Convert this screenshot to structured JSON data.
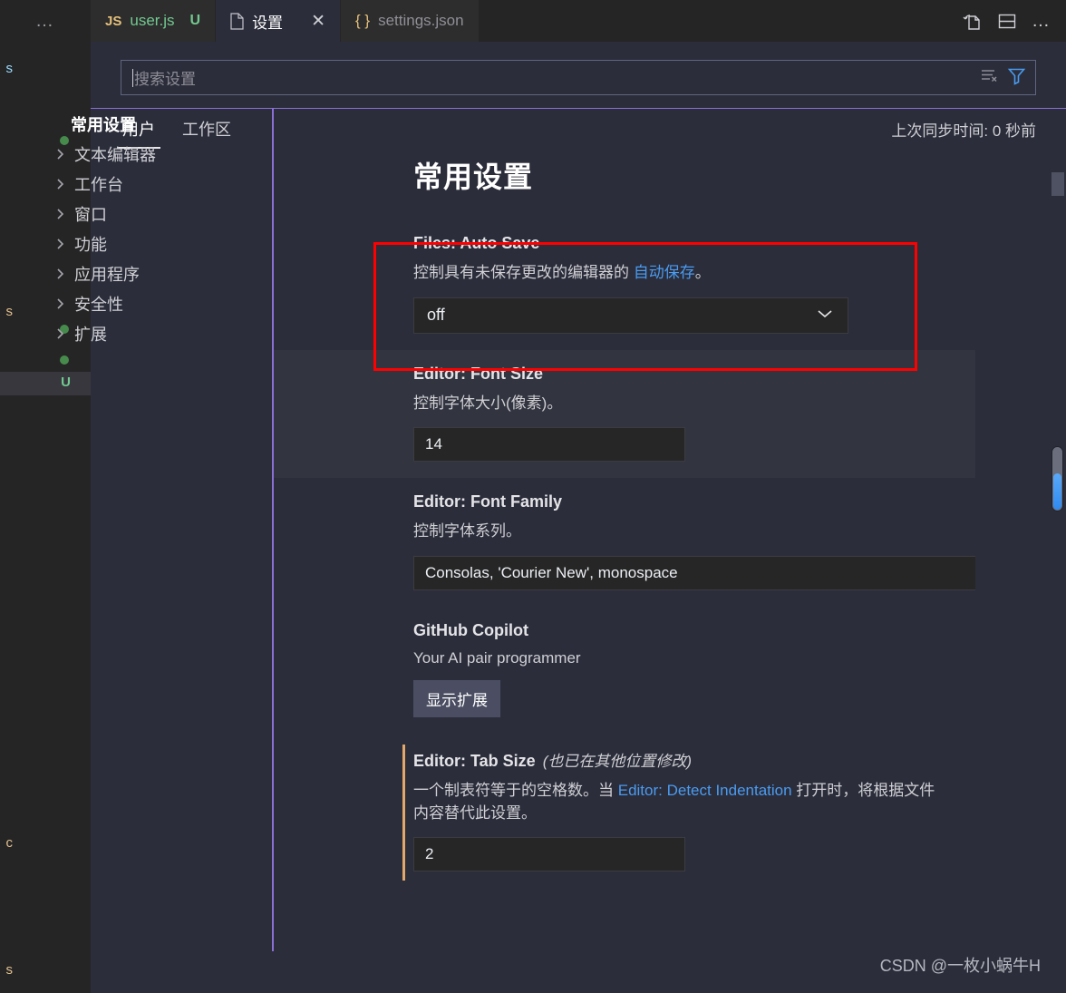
{
  "window": {
    "tabbar": {
      "overflow_label": "…",
      "tabs": [
        {
          "icon": "js-file-icon",
          "label": "user.js",
          "badge": "U",
          "active": false,
          "closable": false
        },
        {
          "icon": "settings-file-icon",
          "label": "设置",
          "badge": "",
          "active": true,
          "closable": true
        },
        {
          "icon": "json-file-icon",
          "label": "settings.json",
          "badge": "",
          "active": false,
          "closable": false
        }
      ],
      "close_label": "✕",
      "actions": [
        {
          "name": "open-changes-icon",
          "label": ""
        },
        {
          "name": "split-editor-icon",
          "label": ""
        },
        {
          "name": "more-actions-icon",
          "label": "…"
        }
      ]
    }
  },
  "explorer": {
    "fragments": [
      {
        "text": "s",
        "color": "blue"
      },
      {
        "text": "s",
        "color": "orange"
      },
      {
        "text": "c",
        "color": "orange"
      },
      {
        "text": "s",
        "color": "orange"
      }
    ],
    "badge": "U"
  },
  "search": {
    "placeholder": "搜索设置",
    "value": "",
    "clear_icon": "clear-settings-search-icon",
    "filter_icon": "filter-icon"
  },
  "scope": {
    "tabs": [
      {
        "label": "用户",
        "active": true
      },
      {
        "label": "工作区",
        "active": false
      }
    ],
    "sync_status": "上次同步时间: 0 秒前"
  },
  "toc": {
    "items": [
      {
        "label": "常用设置",
        "root": true,
        "selected": true
      },
      {
        "label": "文本编辑器",
        "root": false,
        "selected": false
      },
      {
        "label": "工作台",
        "root": false,
        "selected": false
      },
      {
        "label": "窗口",
        "root": false,
        "selected": false
      },
      {
        "label": "功能",
        "root": false,
        "selected": false
      },
      {
        "label": "应用程序",
        "root": false,
        "selected": false
      },
      {
        "label": "安全性",
        "root": false,
        "selected": false
      },
      {
        "label": "扩展",
        "root": false,
        "selected": false
      }
    ]
  },
  "main": {
    "page_title": "常用设置",
    "settings": [
      {
        "key": "files-auto-save",
        "title": "Files: Auto Save",
        "note": "",
        "desc_before": "控制具有未保存更改的编辑器的 ",
        "desc_link": "自动保存",
        "desc_after": "。",
        "control": "select",
        "value": "off",
        "modified": false,
        "hovered": false
      },
      {
        "key": "editor-font-size",
        "title": "Editor: Font Size",
        "note": "",
        "desc_before": "控制字体大小(像素)。",
        "desc_link": "",
        "desc_after": "",
        "control": "input-small",
        "value": "14",
        "modified": false,
        "hovered": true
      },
      {
        "key": "editor-font-family",
        "title": "Editor: Font Family",
        "note": "",
        "desc_before": "控制字体系列。",
        "desc_link": "",
        "desc_after": "",
        "control": "input-wide",
        "value": "Consolas, 'Courier New', monospace",
        "modified": false,
        "hovered": false
      },
      {
        "key": "github-copilot",
        "title": "GitHub Copilot",
        "note": "",
        "desc_before": "Your AI pair programmer",
        "desc_link": "",
        "desc_after": "",
        "control": "button",
        "value": "显示扩展",
        "modified": false,
        "hovered": false
      },
      {
        "key": "editor-tab-size",
        "title": "Editor: Tab Size",
        "note": "(也已在其他位置修改)",
        "desc_before": "一个制表符等于的空格数。当 ",
        "desc_link": "Editor: Detect Indentation",
        "desc_after": " 打开时，将根据文件内容替代此设置。",
        "control": "input-small",
        "value": "2",
        "modified": true,
        "hovered": false
      }
    ]
  },
  "annotation": {
    "type": "red-rectangle",
    "color": "#fe0000",
    "target": "files-auto-save"
  },
  "watermark": "CSDN @一枚小蜗牛H",
  "colors": {
    "editor_bg": "#2b2d3a",
    "tabbar_bg": "#252526",
    "accent_purple": "#8a6fd6",
    "link_blue": "#4a9bf0",
    "modified_orange": "#e2a86b",
    "untracked_green": "#73c991",
    "annotation_red": "#fe0000"
  }
}
